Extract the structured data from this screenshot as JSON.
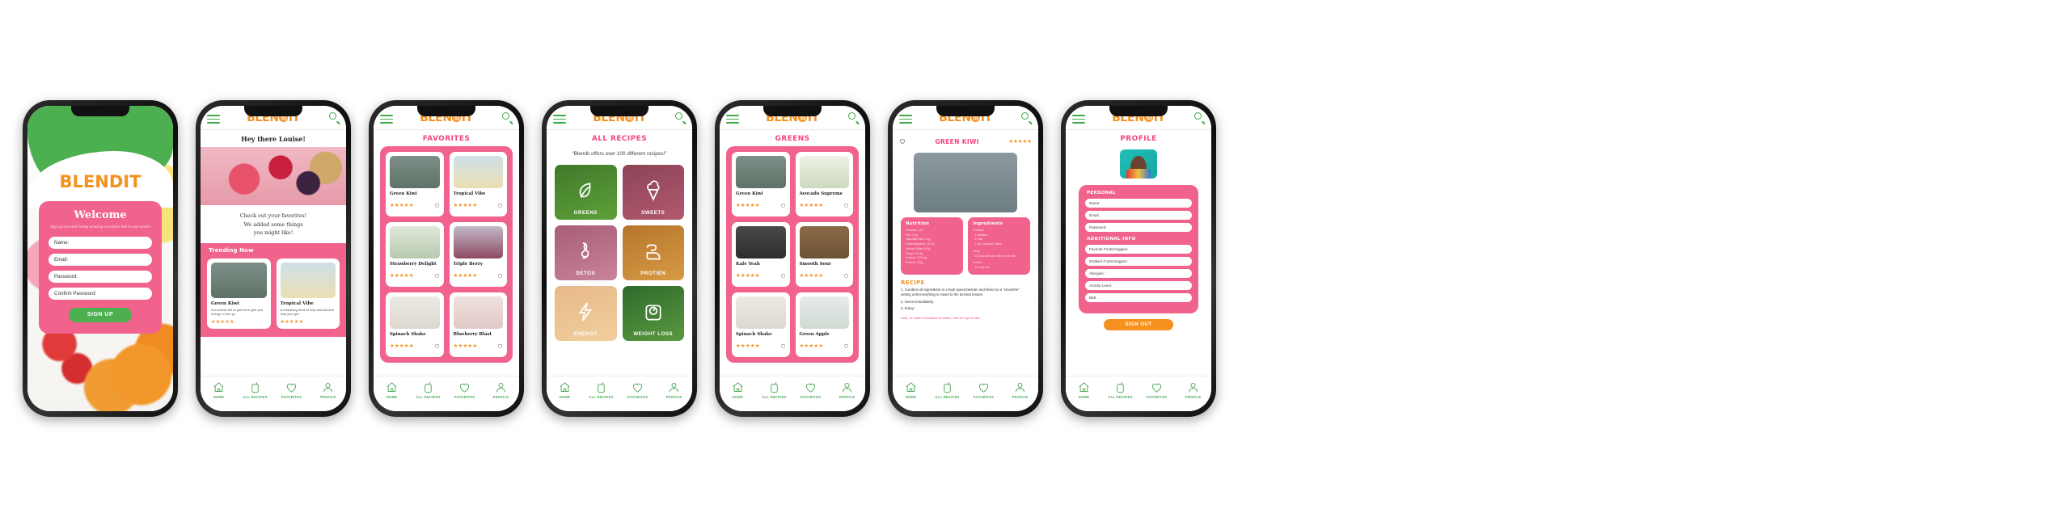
{
  "brand": {
    "name_part1": "BLEN",
    "name_part2": "IT",
    "accent_orange": "#F5911E",
    "accent_pink": "#F1628C",
    "accent_green": "#4CAF50"
  },
  "nav": {
    "items": [
      {
        "label": "HOME",
        "icon": "home-icon"
      },
      {
        "label": "ALL RECIPES",
        "icon": "cup-icon"
      },
      {
        "label": "FAVORITES",
        "icon": "heart-icon"
      },
      {
        "label": "PROFILE",
        "icon": "person-icon"
      }
    ]
  },
  "screen1": {
    "logo": "BLENDIT",
    "welcome_title": "Welcome",
    "welcome_sub": "Sign up and start finding amazing smoothies that fit your needs!",
    "fields": [
      {
        "label": "Name:",
        "value": ""
      },
      {
        "label": "Email:",
        "value": ""
      },
      {
        "label": "Password:",
        "value": ""
      },
      {
        "label": "Confirm Password:",
        "value": ""
      }
    ],
    "signup_label": "SIGN UP"
  },
  "screen2": {
    "greeting": "Hey there Louise!",
    "blurb": "Check out your favorites!\nWe added some things\nyou might like!",
    "trending_title": "Trending Now",
    "cards": [
      {
        "name": "Green Kiwi",
        "desc": "A smoothie full of greens to give you energy on the go",
        "stars": "★★★★★",
        "thumb": "th-green"
      },
      {
        "name": "Tropical Vibe",
        "desc": "A refreshing drink to help debloat and heal your gut",
        "stars": "★★★★★",
        "thumb": "th-tropical"
      }
    ]
  },
  "screen3": {
    "title": "FAVORITES",
    "cards": [
      {
        "name": "Green Kiwi",
        "stars": "★★★★★",
        "thumb": "th-green"
      },
      {
        "name": "Tropical Vibe",
        "stars": "★★★★★",
        "thumb": "th-tropical"
      },
      {
        "name": "Strawberry Delight",
        "stars": "★★★★★",
        "thumb": "th-straw"
      },
      {
        "name": "Triple Berry",
        "stars": "★★★★★",
        "thumb": "th-triple"
      },
      {
        "name": "Spinach Shake",
        "stars": "★★★★★",
        "thumb": "th-spinach"
      },
      {
        "name": "Blueberry Blast",
        "stars": "★★★★★",
        "thumb": "th-blue"
      }
    ]
  },
  "screen4": {
    "title": "ALL RECIPES",
    "quote": "“Blendit offers over 100 different recipes!”",
    "categories": [
      {
        "label": "GREENS",
        "icon": "leaf-icon",
        "bg": "bg-greens"
      },
      {
        "label": "SWEETS",
        "icon": "ice-cream-icon",
        "bg": "bg-sweets"
      },
      {
        "label": "DETOX",
        "icon": "intestine-icon",
        "bg": "bg-detox"
      },
      {
        "label": "PROTIEN",
        "icon": "muscle-arm-icon",
        "bg": "bg-protien"
      },
      {
        "label": "ENERGY",
        "icon": "lightning-bolt-icon",
        "bg": "bg-energy"
      },
      {
        "label": "WEIGHT LOSS",
        "icon": "scale-icon",
        "bg": "bg-weight"
      }
    ]
  },
  "screen5": {
    "title": "GREENS",
    "cards": [
      {
        "name": "Green Kiwi",
        "stars": "★★★★★",
        "thumb": "th-green"
      },
      {
        "name": "Avocado Supreme",
        "stars": "★★★★★",
        "thumb": "th-avocado"
      },
      {
        "name": "Kale Yeah",
        "stars": "★★★★★",
        "thumb": "th-kale"
      },
      {
        "name": "Smooth Sour",
        "stars": "★★★★★",
        "thumb": "th-sour"
      },
      {
        "name": "Spinach Shake",
        "stars": "★★★★★",
        "thumb": "th-spinach"
      },
      {
        "name": "Green Apple",
        "stars": "★★★★★",
        "thumb": "th-apple"
      }
    ]
  },
  "screen6": {
    "title": "GREEN KIWI",
    "stars": "★★★★★",
    "nutrition_title": "Nutrition",
    "nutrition": "Calories: 173\nFat: 2.2g\nSaturated fat: 0.2g\nCarbohydrates: 39.7g\nDietary Fiber: 5.5g\nSugar: 21.4g\nSodium: 107mg\nProtein: 3.5g",
    "ingredients_title": "Ingredients",
    "ing_produce_h": "Produce",
    "ing_produce": "· 1 Banana\n· 1 Kiwi\n· 1 cup Spinach, fresh",
    "ing_dairy_h": "Dairy",
    "ing_dairy": "· 1/2 cup Almond milk or nut milk",
    "ing_frozen_h": "Frozen",
    "ing_frozen": "· 1/2 cup Ice",
    "recipe_title": "RECIPE",
    "steps": [
      "1. Combine all ingredients in a high speed blender and blend on a “smoothie” setting until everything is mixed to the desired texture.",
      "2. Serve immediately.",
      "3. Enjoy!"
    ],
    "note": "Note: To make a breakfast smoothie, add 1/2 cup of oats."
  },
  "screen7": {
    "title": "PROFILE",
    "personal_h": "PERSONAL",
    "personal_fields": [
      {
        "label": "Name:",
        "value": ""
      },
      {
        "label": "Email:",
        "value": ""
      },
      {
        "label": "Password:",
        "value": ""
      }
    ],
    "additional_h": "ADDITIONAL INFO",
    "additional_fields": [
      {
        "label": "Favorite Fruits/Veggies:",
        "value": ""
      },
      {
        "label": "Disliked Fruits/Veggies:",
        "value": ""
      },
      {
        "label": "Allergies:",
        "value": ""
      },
      {
        "label": "Activity Level:",
        "value": ""
      },
      {
        "label": "BMI:",
        "value": ""
      }
    ],
    "signout_label": "SIGN OUT"
  }
}
